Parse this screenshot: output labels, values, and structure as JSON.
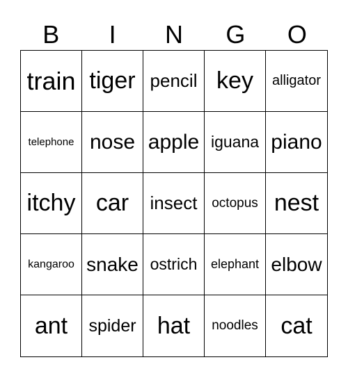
{
  "header": [
    "B",
    "I",
    "N",
    "G",
    "O"
  ],
  "cells": [
    "train",
    "tiger",
    "pencil",
    "key",
    "alligator",
    "telephone",
    "nose",
    "apple",
    "iguana",
    "piano",
    "itchy",
    "car",
    "insect",
    "octopus",
    "nest",
    "kangaroo",
    "snake",
    "ostrich",
    "elephant",
    "elbow",
    "ant",
    "spider",
    "hat",
    "noodles",
    "cat"
  ]
}
